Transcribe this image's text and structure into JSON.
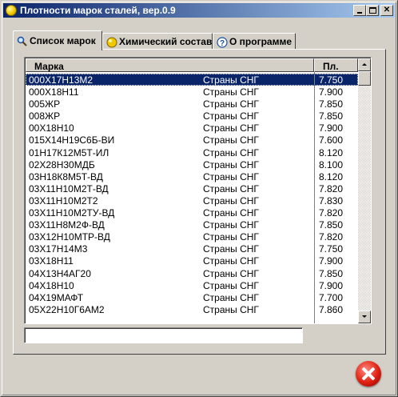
{
  "window": {
    "title": "Плотности марок сталей, вер.0.9",
    "icon": "yellow-circle-icon"
  },
  "tabs": [
    {
      "label": "Список марок",
      "icon": "magnifier-list-icon",
      "active": true
    },
    {
      "label": "Химический состав",
      "icon": "yellow-circle-icon",
      "active": false
    },
    {
      "label": "О программе",
      "icon": "question-icon",
      "active": false
    }
  ],
  "table": {
    "columns": [
      "Марка",
      "Пл."
    ],
    "rows": [
      {
        "name": "000Х17Н13М2",
        "origin": "Страны СНГ",
        "density": "7.750",
        "selected": true
      },
      {
        "name": "000Х18Н11",
        "origin": "Страны СНГ",
        "density": "7.900"
      },
      {
        "name": "005ЖР",
        "origin": "Страны СНГ",
        "density": "7.850"
      },
      {
        "name": "008ЖР",
        "origin": "Страны СНГ",
        "density": "7.850"
      },
      {
        "name": "00Х18Н10",
        "origin": "Страны СНГ",
        "density": "7.900"
      },
      {
        "name": "015Х14Н19С6Б-ВИ",
        "origin": "Страны СНГ",
        "density": "7.600"
      },
      {
        "name": "01Н17К12М5Т-ИЛ",
        "origin": "Страны СНГ",
        "density": "8.120"
      },
      {
        "name": "02Х28Н30МДБ",
        "origin": "Страны СНГ",
        "density": "8.100"
      },
      {
        "name": "03Н18К8М5Т-ВД",
        "origin": "Страны СНГ",
        "density": "8.120"
      },
      {
        "name": "03Х11Н10М2Т-ВД",
        "origin": "Страны СНГ",
        "density": "7.820"
      },
      {
        "name": "03Х11Н10М2Т2",
        "origin": "Страны СНГ",
        "density": "7.830"
      },
      {
        "name": "03Х11Н10М2ТУ-ВД",
        "origin": "Страны СНГ",
        "density": "7.820"
      },
      {
        "name": "03Х11Н8М2Ф-ВД",
        "origin": "Страны СНГ",
        "density": "7.850"
      },
      {
        "name": "03Х12Н10МТР-ВД",
        "origin": "Страны СНГ",
        "density": "7.820"
      },
      {
        "name": "03Х17Н14М3",
        "origin": "Страны СНГ",
        "density": "7.750"
      },
      {
        "name": "03Х18Н11",
        "origin": "Страны СНГ",
        "density": "7.900"
      },
      {
        "name": "04Х13Н4АГ20",
        "origin": "Страны СНГ",
        "density": "7.850"
      },
      {
        "name": "04Х18Н10",
        "origin": "Страны СНГ",
        "density": "7.900"
      },
      {
        "name": "04Х19МАФТ",
        "origin": "Страны СНГ",
        "density": "7.700"
      },
      {
        "name": "05Х22Н10Г6АМ2",
        "origin": "Страны СНГ",
        "density": "7.860"
      }
    ]
  },
  "search": {
    "value": "",
    "placeholder": ""
  },
  "exit_button": {
    "icon": "close-red-icon"
  }
}
